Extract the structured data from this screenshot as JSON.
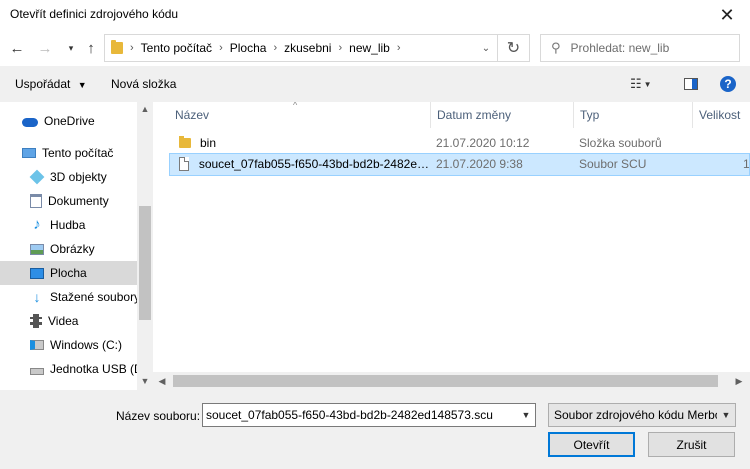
{
  "window": {
    "title": "Otevřít definici zdrojového kódu"
  },
  "nav": {
    "breadcrumbs": [
      "Tento počítač",
      "Plocha",
      "zkusebni",
      "new_lib"
    ],
    "search_placeholder": "Prohledat: new_lib"
  },
  "toolbar": {
    "organize_label": "Uspořádat",
    "new_folder_label": "Nová složka"
  },
  "sidebar": {
    "items": [
      {
        "label": "OneDrive",
        "icon": "cloud-icon"
      },
      {
        "label": "Tento počítač",
        "icon": "computer-icon"
      },
      {
        "label": "3D objekty",
        "icon": "cube-3d-icon"
      },
      {
        "label": "Dokumenty",
        "icon": "documents-icon"
      },
      {
        "label": "Hudba",
        "icon": "music-note-icon"
      },
      {
        "label": "Obrázky",
        "icon": "pictures-icon"
      },
      {
        "label": "Plocha",
        "icon": "desktop-icon",
        "selected": true
      },
      {
        "label": "Stažené soubory",
        "icon": "download-arrow-icon"
      },
      {
        "label": "Videa",
        "icon": "film-icon"
      },
      {
        "label": "Windows  (C:)",
        "icon": "drive-windows-icon"
      },
      {
        "label": "Jednotka USB (D",
        "icon": "usb-drive-icon"
      }
    ]
  },
  "filelist": {
    "columns": [
      "Název",
      "Datum změny",
      "Typ",
      "Velikost"
    ],
    "rows": [
      {
        "name": "bin",
        "date": "21.07.2020 10:12",
        "type": "Složka souborů",
        "size": "",
        "icon": "folder-icon"
      },
      {
        "name": "soucet_07fab055-f650-43bd-bd2b-2482e…",
        "date": "21.07.2020 9:38",
        "type": "Soubor SCU",
        "size": "1",
        "icon": "document-icon",
        "selected": true
      }
    ]
  },
  "bottom": {
    "filename_label": "Název souboru:",
    "filename_value": "soucet_07fab055-f650-43bd-bd2b-2482ed148573.scu",
    "filetype_value": "Soubor zdrojového kódu Merbo",
    "open_label": "Otevřít",
    "cancel_label": "Zrušit"
  },
  "colors": {
    "accent": "#0078d7",
    "selection": "#cce8ff",
    "folder": "#e8b83a"
  }
}
